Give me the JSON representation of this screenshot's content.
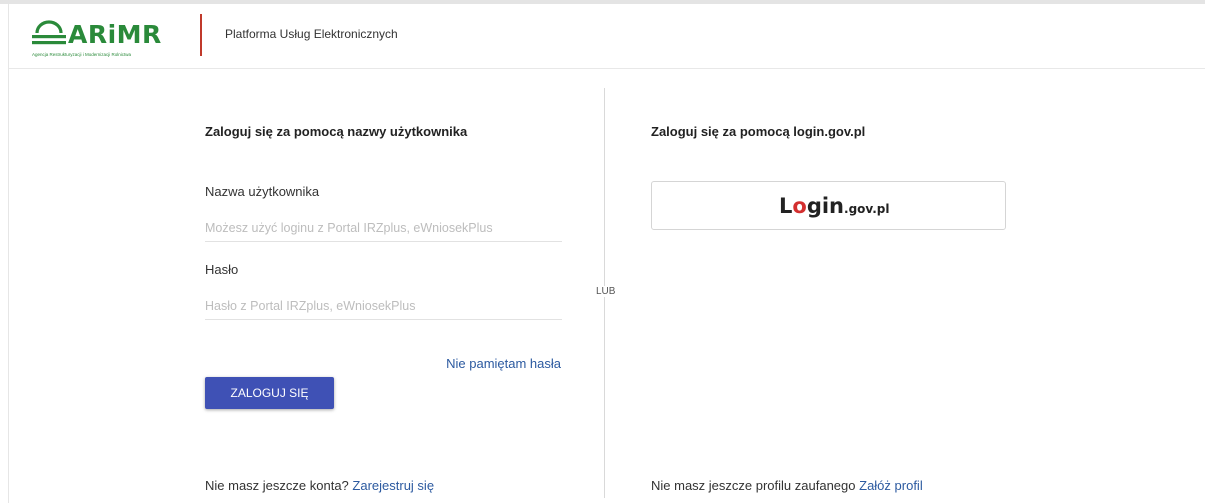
{
  "header": {
    "logo_text": "ARiMR",
    "logo_subtitle": "Agencja Restrukturyzacji i Modernizacji Rolnictwa",
    "title": "Platforma Usług Elektronicznych"
  },
  "separator": "LUB",
  "username_login": {
    "title": "Zaloguj się za pomocą nazwy użytkownika",
    "username_label": "Nazwa użytkownika",
    "username_placeholder": "Możesz użyć loginu z Portal IRZplus, eWniosekPlus",
    "username_value": "",
    "password_label": "Hasło",
    "password_placeholder": "Hasło z Portal IRZplus, eWniosekPlus",
    "password_value": "",
    "forgot_link": "Nie pamiętam hasła",
    "login_button": "ZALOGUJ SIĘ",
    "no_account_text": "Nie masz jeszcze konta?",
    "register_link": "Zarejestruj się"
  },
  "gov_login": {
    "title": "Zaloguj się za pomocą login.gov.pl",
    "button_brand_prefix": "L",
    "button_brand_o": "o",
    "button_brand_main": "gin",
    "button_brand_suffix": ".gov.pl",
    "no_profile_text": "Nie masz jeszcze profilu zaufanego",
    "create_profile_link": "Załóż profil"
  },
  "colors": {
    "brand_green": "#2a8a3a",
    "header_divider": "#c0392b",
    "primary_button": "#3f51b5",
    "link": "#2c5aa0",
    "login_gov_accent": "#d32f2f"
  }
}
